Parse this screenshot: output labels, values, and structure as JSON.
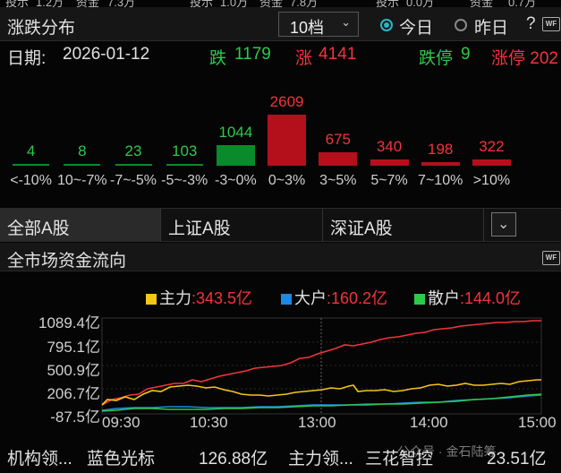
{
  "top_strip": [
    "投示",
    "1.2万",
    "资金",
    "7.3万",
    "投示",
    "1.0万",
    "资金",
    "7.8万",
    "投示",
    "0.0万",
    "资金",
    "0.7万"
  ],
  "header": {
    "title": "涨跌分布",
    "level_select": "10档",
    "radio_today": "今日",
    "radio_yesterday": "昨日",
    "help": "?",
    "logo": "WF"
  },
  "summary": {
    "date_label": "日期:",
    "date": "2026-01-12",
    "fall_label": "跌",
    "fall_count": "1179",
    "rise_label": "涨",
    "rise_count": "4141",
    "limit_down_label": "跌停",
    "limit_down_count": "9",
    "limit_up_label": "涨停",
    "limit_up_count": "202"
  },
  "chart_data": [
    {
      "type": "bar",
      "categories": [
        "<-10%",
        "10~-7%",
        "-7~-5%",
        "-5~-3%",
        "-3~0%",
        "0~3%",
        "3~5%",
        "5~7%",
        "7~10%",
        ">10%"
      ],
      "values": [
        4,
        8,
        23,
        103,
        1044,
        2609,
        675,
        340,
        198,
        322
      ],
      "colors": [
        "#2dc94b",
        "#2dc94b",
        "#2dc94b",
        "#2dc94b",
        "#2dc94b",
        "#f2343a",
        "#f2343a",
        "#f2343a",
        "#f2343a",
        "#f2343a"
      ],
      "labels_display": [
        "4",
        "8",
        "23",
        "103",
        "1044",
        "2609",
        "675",
        "340",
        "198",
        "322"
      ]
    },
    {
      "type": "line",
      "x_ticks": [
        "09:30",
        "10:30",
        "13:00",
        "14:00",
        "15:00"
      ],
      "y_ticks": [
        "1089.4亿",
        "795.1亿",
        "500.9亿",
        "206.7亿",
        "-87.5亿"
      ],
      "ylim": [
        -87.5,
        1089.4
      ],
      "series": [
        {
          "name": "主力",
          "value_label": ":343.5亿",
          "color": "#f5c518"
        },
        {
          "name": "大户",
          "value_label": ":160.2亿",
          "color": "#1e88e5"
        },
        {
          "name": "散户",
          "value_label": ":144.0亿",
          "color": "#2dc94b"
        }
      ]
    }
  ],
  "tabs": {
    "all": "全部A股",
    "sh": "上证A股",
    "sz": "深证A股"
  },
  "flow": {
    "title": "全市场资金流向",
    "logo": "WF"
  },
  "bottom": {
    "c1": "机构领...",
    "c2": "蓝色光标",
    "c3": "126.88亿",
    "c4": "主力领...",
    "c5": "三花智控",
    "c6": "23.51亿",
    "watermark": "公众号 · 金石陆筹"
  }
}
